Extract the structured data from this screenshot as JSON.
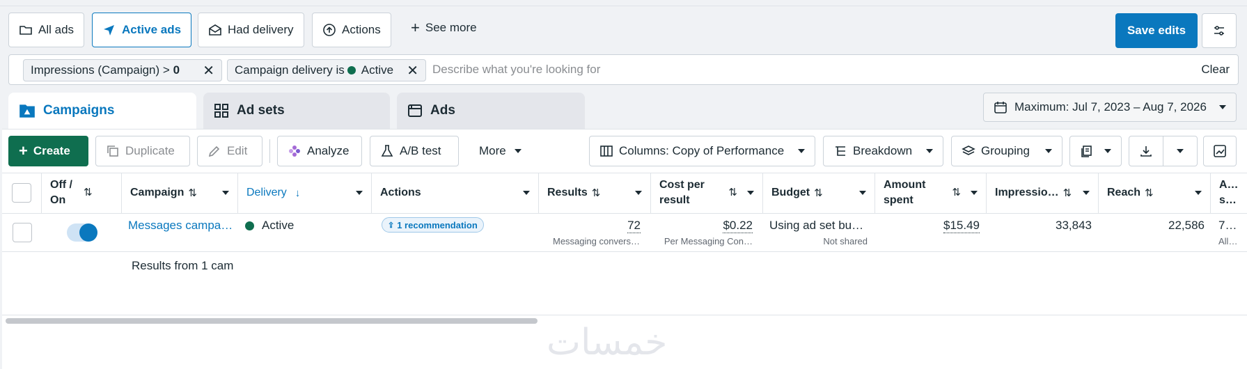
{
  "top_tabs": [
    "All ads",
    "Active ads",
    "Had delivery",
    "Actions"
  ],
  "see_more": "See more",
  "save_edits": "Save edits",
  "filters": {
    "chip1": {
      "label": "Impressions (Campaign) > ",
      "value": "0"
    },
    "chip2": {
      "label": "Campaign delivery is",
      "value": "Active"
    },
    "placeholder": "Describe what you're looking for",
    "clear": "Clear"
  },
  "level_tabs": [
    "Campaigns",
    "Ad sets",
    "Ads"
  ],
  "date_range": "Maximum: Jul 7, 2023 – Aug 7, 2026",
  "toolbar": {
    "create": "Create",
    "duplicate": "Duplicate",
    "edit": "Edit",
    "analyze": "Analyze",
    "ab_test": "A/B test",
    "more": "More",
    "columns": "Columns: Copy of Performance",
    "breakdown": "Breakdown",
    "grouping": "Grouping"
  },
  "columns": {
    "off_on_1": "Off /",
    "off_on_2": "On",
    "campaign": "Campaign",
    "delivery": "Delivery",
    "actions": "Actions",
    "results": "Results",
    "cost_1": "Cost per",
    "cost_2": "result",
    "budget": "Budget",
    "amount_1": "Amount",
    "amount_2": "spent",
    "impressions": "Impressio…",
    "reach": "Reach",
    "a_1": "A…",
    "a_2": "s…"
  },
  "row": {
    "campaign": "Messages campa…",
    "delivery": "Active",
    "recommendation": "1 recommendation",
    "results": "72",
    "results_sub": "Messaging convers…",
    "cost": "$0.22",
    "cost_sub": "Per Messaging Con…",
    "budget": "Using ad set bu…",
    "budget_sub": "Not shared",
    "amount": "$15.49",
    "impressions": "33,843",
    "reach": "22,586",
    "last": "7…",
    "last_sub": "All…"
  },
  "summary": "Results from 1 cam",
  "watermark": "خمسات",
  "colors": {
    "accent": "#0a78be",
    "create": "#0f6e4f",
    "active_dot": "#0f6e4f"
  }
}
